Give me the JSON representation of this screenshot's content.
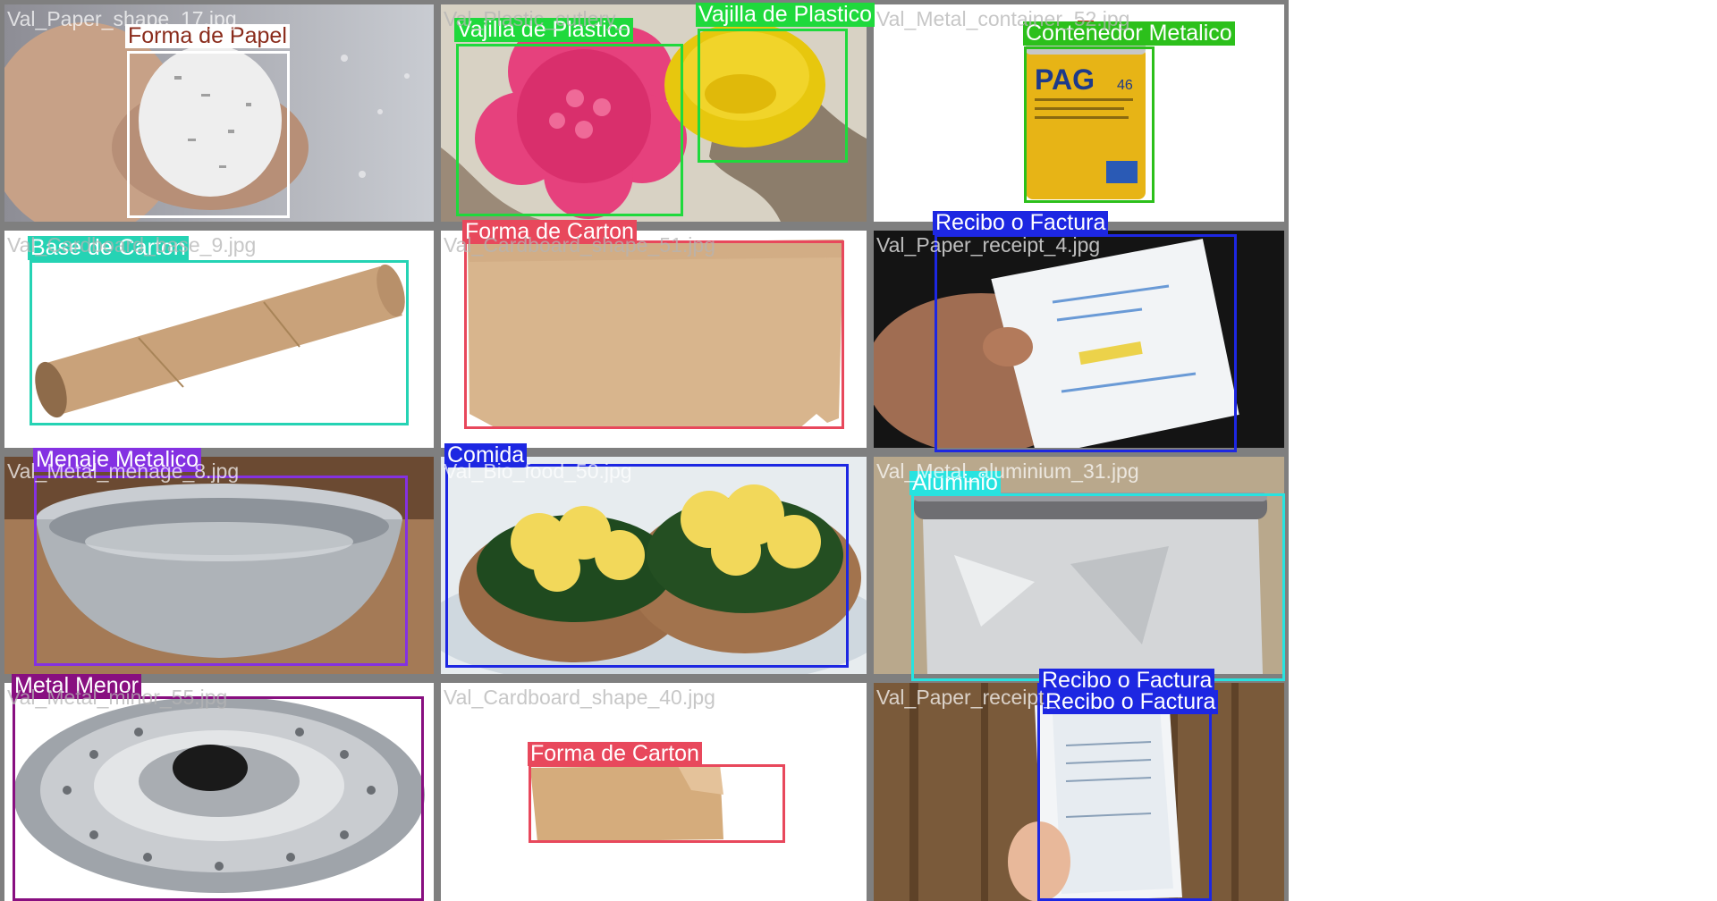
{
  "colors": {
    "paper_shape": "#ffffff",
    "plastic": "#1fd93c",
    "metal_container": "#2cc01b",
    "cardboard_base": "#25d3b4",
    "cardboard_shape": "#e8485c",
    "receipt": "#1d27e2",
    "metal_household": "#8431e2",
    "food": "#1d27e2",
    "aluminium": "#27e3e0",
    "metal_minor": "#880f80"
  },
  "tiles": [
    {
      "filename": "Val_Paper_shape_17.jpg",
      "image": "shredded-paper-photo"
    },
    {
      "filename": "Val_Plastic_cutlery_",
      "image": "plastic-dishes-photo"
    },
    {
      "filename": "Val_Metal_container_52.jpg",
      "image": "metal-can-photo"
    },
    {
      "filename": "Val_Cardboard_base_9.jpg",
      "image": "cardboard-tube-photo"
    },
    {
      "filename": "Val_Cardboard_shape_51.jpg",
      "image": "cardboard-sheet-photo"
    },
    {
      "filename": "Val_Paper_receipt_4.jpg",
      "image": "receipt-in-hand-photo"
    },
    {
      "filename": "Val_Metal_menage_8.jpg",
      "image": "metal-basin-photo"
    },
    {
      "filename": "Val_Bio_food_50.jpg",
      "image": "egg-toast-photo"
    },
    {
      "filename": "Val_Metal_aluminium_31.jpg",
      "image": "aluminium-foil-photo"
    },
    {
      "filename": "Val_Metal_minor_55.jpg",
      "image": "metal-pot-lid-photo"
    },
    {
      "filename": "Val_Cardboard_shape_40.jpg",
      "image": "cardboard-piece-photo"
    },
    {
      "filename": "Val_Paper_receipt_",
      "image": "receipts-held-photo"
    }
  ],
  "detections": [
    {
      "label": "Forma de Papel",
      "label_color": "#8a2b1b",
      "color_key": "paper_shape"
    },
    {
      "label": "Vajilla de Plastico",
      "color_key": "plastic"
    },
    {
      "label": "Vajilla de Plastico",
      "color_key": "plastic"
    },
    {
      "label": "Contenedor Metalico",
      "color_key": "metal_container"
    },
    {
      "label": "Base de Carton",
      "color_key": "cardboard_base"
    },
    {
      "label": "Forma de Carton",
      "color_key": "cardboard_shape"
    },
    {
      "label": "Recibo o Factura",
      "color_key": "receipt"
    },
    {
      "label": "Menaje Metalico",
      "color_key": "metal_household"
    },
    {
      "label": "Comida",
      "color_key": "food"
    },
    {
      "label": "Aluminio",
      "color_key": "aluminium"
    },
    {
      "label": "Metal Menor",
      "color_key": "metal_minor"
    },
    {
      "label": "Forma de Carton",
      "color_key": "cardboard_shape"
    },
    {
      "label": "Recibo o Factura",
      "color_key": "receipt"
    },
    {
      "label": "Recibo o Factura",
      "color_key": "receipt"
    }
  ]
}
